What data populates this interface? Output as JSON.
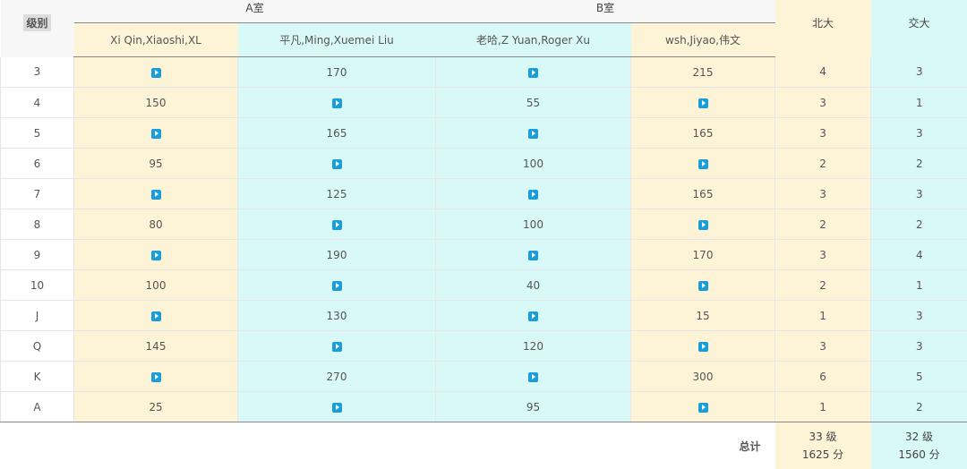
{
  "header": {
    "level_label": "级别",
    "room_a": "A室",
    "room_b": "B室",
    "uni_1": "北大",
    "uni_2": "交大",
    "players": [
      "Xi Qin,Xiaoshi,XL",
      "平凡,Ming,Xuemei Liu",
      "老哈,Z Yuan,Roger Xu",
      "wsh,Jiyao,伟文"
    ]
  },
  "icons": {
    "play": "play-video-icon",
    "accent": "#1a9ddb"
  },
  "colors": {
    "yellow": "#fdf3d6",
    "cyan": "#d9f8f8"
  },
  "rows": [
    {
      "level": "3",
      "a1": "",
      "a2": "170",
      "b1": "",
      "b2": "215",
      "u1": "4",
      "u2": "3"
    },
    {
      "level": "4",
      "a1": "150",
      "a2": "",
      "b1": "55",
      "b2": "",
      "u1": "3",
      "u2": "1"
    },
    {
      "level": "5",
      "a1": "",
      "a2": "165",
      "b1": "",
      "b2": "165",
      "u1": "3",
      "u2": "3"
    },
    {
      "level": "6",
      "a1": "95",
      "a2": "",
      "b1": "100",
      "b2": "",
      "u1": "2",
      "u2": "2"
    },
    {
      "level": "7",
      "a1": "",
      "a2": "125",
      "b1": "",
      "b2": "165",
      "u1": "3",
      "u2": "3"
    },
    {
      "level": "8",
      "a1": "80",
      "a2": "",
      "b1": "100",
      "b2": "",
      "u1": "2",
      "u2": "2"
    },
    {
      "level": "9",
      "a1": "",
      "a2": "190",
      "b1": "",
      "b2": "170",
      "u1": "3",
      "u2": "4"
    },
    {
      "level": "10",
      "a1": "100",
      "a2": "",
      "b1": "40",
      "b2": "",
      "u1": "2",
      "u2": "1"
    },
    {
      "level": "J",
      "a1": "",
      "a2": "130",
      "b1": "",
      "b2": "15",
      "u1": "1",
      "u2": "3"
    },
    {
      "level": "Q",
      "a1": "145",
      "a2": "",
      "b1": "120",
      "b2": "",
      "u1": "3",
      "u2": "3"
    },
    {
      "level": "K",
      "a1": "",
      "a2": "270",
      "b1": "",
      "b2": "300",
      "u1": "6",
      "u2": "5"
    },
    {
      "level": "A",
      "a1": "25",
      "a2": "",
      "b1": "95",
      "b2": "",
      "u1": "1",
      "u2": "2"
    }
  ],
  "total": {
    "label": "总计",
    "uni_1_levels": "33 级",
    "uni_1_points": "1625 分",
    "uni_2_levels": "32 级",
    "uni_2_points": "1560 分"
  }
}
